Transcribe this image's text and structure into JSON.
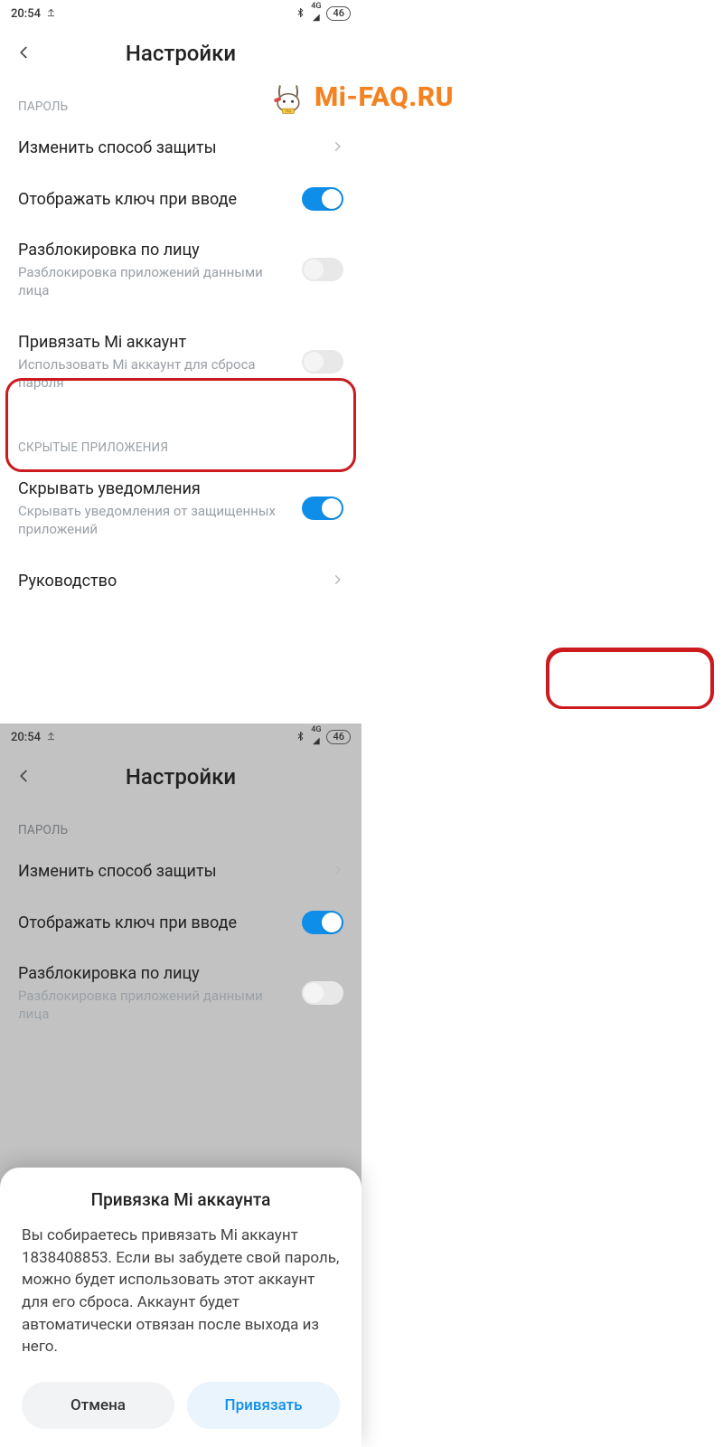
{
  "status": {
    "time": "20:54",
    "upload_icon": "↥",
    "bt_icon": "✱",
    "net_label": "4G",
    "signal_icon": "▂▃▅",
    "battery": "46"
  },
  "appbar": {
    "title": "Настройки"
  },
  "sections": {
    "password_label": "ПАРОЛЬ",
    "hidden_apps_label": "СКРЫТЫЕ ПРИЛОЖЕНИЯ"
  },
  "rows": {
    "change_method": {
      "primary": "Изменить способ защиты"
    },
    "show_key": {
      "primary": "Отображать ключ при вводе"
    },
    "face_unlock": {
      "primary": "Разблокировка по лицу",
      "secondary": "Разблокировка приложений данными лица"
    },
    "bind_mi": {
      "primary": "Привязать Mi аккаунт",
      "secondary": "Использовать Mi аккаунт для сброса пароля"
    },
    "hide_notif": {
      "primary": "Скрывать уведомления",
      "secondary": "Скрывать уведомления от защищенных приложений"
    },
    "guide": {
      "primary": "Руководство"
    }
  },
  "dialog": {
    "title": "Привязка Mi аккаунта",
    "body": "Вы собираетесь привязать Mi аккаунт 1838408853. Если вы забудете свой пароль, можно будет использовать этот аккаунт для его сброса. Аккаунт будет автоматически отвязан после выхода из него.",
    "cancel": "Отмена",
    "confirm": "Привязать"
  },
  "watermark": {
    "text_prefix": "M",
    "text_rest": "i-FAQ.RU"
  }
}
